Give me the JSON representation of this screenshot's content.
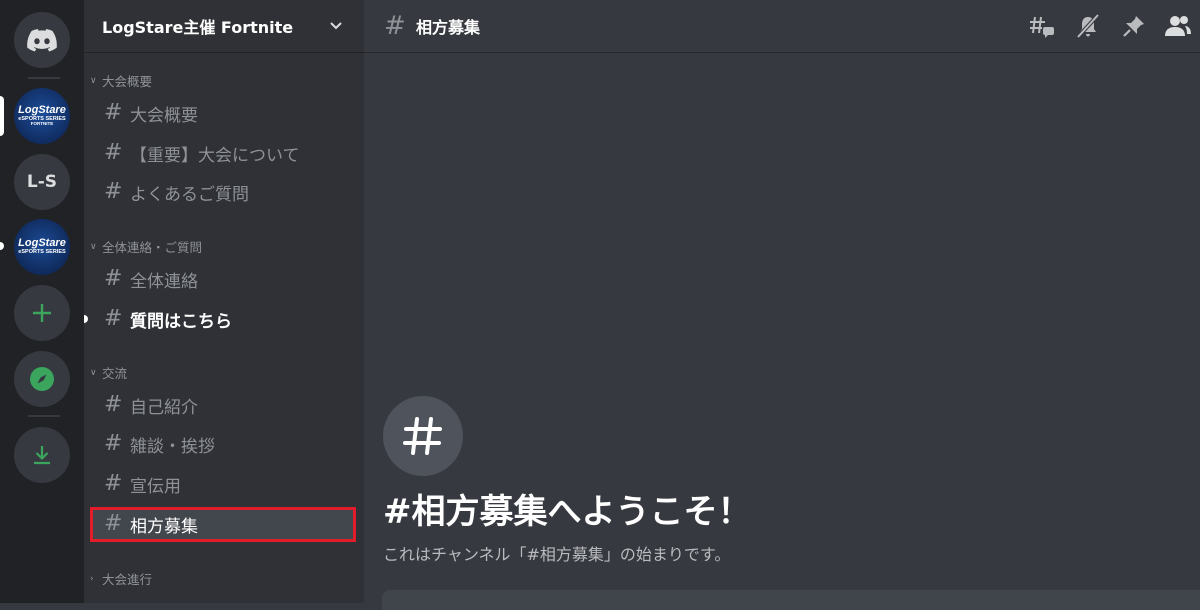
{
  "rail": {
    "servers": [
      {
        "name": "home",
        "icon": "discord-logo-icon"
      },
      {
        "name": "logstare-fortnite",
        "logo_lines": [
          "LogStare",
          "eSPORTS SERIES",
          "FORTNITE"
        ]
      },
      {
        "name": "ls",
        "label": "L-S"
      },
      {
        "name": "logstare-series",
        "logo_lines": [
          "LogStare",
          "eSPORTS SERIES"
        ]
      }
    ],
    "add_icon": "plus-icon",
    "explore_icon": "compass-icon",
    "download_icon": "download-icon"
  },
  "sidebar": {
    "server_name": "LogStare主催 Fortnite",
    "categories": [
      {
        "label": "大会概要",
        "channels": [
          "大会概要",
          "【重要】大会について",
          "よくあるご質問"
        ]
      },
      {
        "label": "全体連絡・ご質問",
        "channels": [
          "全体連絡",
          "質問はこちら"
        ]
      },
      {
        "label": "交流",
        "channels": [
          "自己紹介",
          "雑談・挨拶",
          "宣伝用",
          "相方募集"
        ]
      },
      {
        "label": "大会進行",
        "channels": []
      }
    ],
    "hash": "#"
  },
  "header": {
    "hash": "#",
    "channel_name": "相方募集",
    "icons": [
      "threads-icon",
      "mute-icon",
      "pin-icon",
      "members-icon"
    ]
  },
  "welcome": {
    "hash": "#",
    "title": "#相方募集へようこそ！",
    "subtitle": "これはチャンネル「#相方募集」の始まりです。"
  },
  "colors": {
    "accent_green": "#3ba55d",
    "highlight_red": "#e11d2a",
    "bg_main": "#36393f",
    "bg_sidebar": "#2f3136",
    "bg_rail": "#202225"
  }
}
